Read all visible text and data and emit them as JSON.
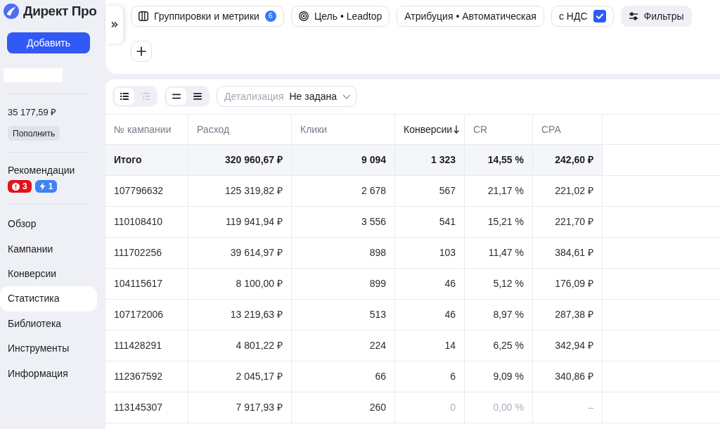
{
  "sidebar": {
    "logo": {
      "text": "Директ Про"
    },
    "add_button": "Добавить",
    "balance": "35 177,59 ₽",
    "top_up_button": "Пополнить",
    "recommendations": {
      "title": "Рекомендации",
      "badges": [
        {
          "kind": "alert",
          "count": "3",
          "color": "#e3111b"
        },
        {
          "kind": "boost",
          "count": "1",
          "color": "#3d82f6"
        }
      ]
    },
    "nav_items": [
      {
        "label": "Обзор",
        "selected": false
      },
      {
        "label": "Кампании",
        "selected": false
      },
      {
        "label": "Конверсии",
        "selected": false
      },
      {
        "label": "Статистика",
        "selected": true
      },
      {
        "label": "Библиотека",
        "selected": false
      },
      {
        "label": "Инструменты",
        "selected": false
      },
      {
        "label": "Информация",
        "selected": false
      }
    ]
  },
  "filters": {
    "chips": [
      {
        "kind": "groupings",
        "label": "Группировки и метрики",
        "badge": "6"
      },
      {
        "kind": "goal",
        "label": "Цель • Leadtop"
      },
      {
        "kind": "attribution",
        "label": "Атрибуция • Автоматическая"
      },
      {
        "kind": "vat",
        "label": "с НДС",
        "checked": true
      },
      {
        "kind": "filters",
        "label": "Фильтры"
      }
    ]
  },
  "toolbar": {
    "view_toggle": [
      {
        "kind": "list",
        "selected": true,
        "disabled": false
      },
      {
        "kind": "grouped-list",
        "selected": false,
        "disabled": true
      }
    ],
    "density_toggle": [
      {
        "kind": "two-lines",
        "selected": true
      },
      {
        "kind": "three-lines",
        "selected": false
      }
    ],
    "detail_dropdown": {
      "label": "Детализация",
      "value": "Не задана"
    }
  },
  "table": {
    "columns": [
      {
        "label": "№ кампании",
        "sorted": false
      },
      {
        "label": "Расход",
        "sorted": false
      },
      {
        "label": "Клики",
        "sorted": false
      },
      {
        "label": "Конверсии",
        "sorted": true
      },
      {
        "label": "CR",
        "sorted": false
      },
      {
        "label": "CPA",
        "sorted": false
      }
    ],
    "rows": [
      {
        "kind": "total",
        "cells": [
          {
            "text": "Итого",
            "muted": false
          },
          {
            "text": "320 960,67 ₽",
            "muted": false
          },
          {
            "text": "9 094",
            "muted": false
          },
          {
            "text": "1 323",
            "muted": false
          },
          {
            "text": "14,55 %",
            "muted": false
          },
          {
            "text": "242,60 ₽",
            "muted": false
          }
        ]
      },
      {
        "kind": "campaign",
        "cells": [
          {
            "text": "107796632",
            "muted": false
          },
          {
            "text": "125 319,82 ₽",
            "muted": false
          },
          {
            "text": "2 678",
            "muted": false
          },
          {
            "text": "567",
            "muted": false
          },
          {
            "text": "21,17 %",
            "muted": false
          },
          {
            "text": "221,02 ₽",
            "muted": false
          }
        ]
      },
      {
        "kind": "campaign",
        "cells": [
          {
            "text": "110108410",
            "muted": false
          },
          {
            "text": "119 941,94 ₽",
            "muted": false
          },
          {
            "text": "3 556",
            "muted": false
          },
          {
            "text": "541",
            "muted": false
          },
          {
            "text": "15,21 %",
            "muted": false
          },
          {
            "text": "221,70 ₽",
            "muted": false
          }
        ]
      },
      {
        "kind": "campaign",
        "cells": [
          {
            "text": "111702256",
            "muted": false
          },
          {
            "text": "39 614,97 ₽",
            "muted": false
          },
          {
            "text": "898",
            "muted": false
          },
          {
            "text": "103",
            "muted": false
          },
          {
            "text": "11,47 %",
            "muted": false
          },
          {
            "text": "384,61 ₽",
            "muted": false
          }
        ]
      },
      {
        "kind": "campaign",
        "cells": [
          {
            "text": "104115617",
            "muted": false
          },
          {
            "text": "8 100,00 ₽",
            "muted": false
          },
          {
            "text": "899",
            "muted": false
          },
          {
            "text": "46",
            "muted": false
          },
          {
            "text": "5,12 %",
            "muted": false
          },
          {
            "text": "176,09 ₽",
            "muted": false
          }
        ]
      },
      {
        "kind": "campaign",
        "cells": [
          {
            "text": "107172006",
            "muted": false
          },
          {
            "text": "13 219,63 ₽",
            "muted": false
          },
          {
            "text": "513",
            "muted": false
          },
          {
            "text": "46",
            "muted": false
          },
          {
            "text": "8,97 %",
            "muted": false
          },
          {
            "text": "287,38 ₽",
            "muted": false
          }
        ]
      },
      {
        "kind": "campaign",
        "cells": [
          {
            "text": "111428291",
            "muted": false
          },
          {
            "text": "4 801,22 ₽",
            "muted": false
          },
          {
            "text": "224",
            "muted": false
          },
          {
            "text": "14",
            "muted": false
          },
          {
            "text": "6,25 %",
            "muted": false
          },
          {
            "text": "342,94 ₽",
            "muted": false
          }
        ]
      },
      {
        "kind": "campaign",
        "cells": [
          {
            "text": "112367592",
            "muted": false
          },
          {
            "text": "2 045,17 ₽",
            "muted": false
          },
          {
            "text": "66",
            "muted": false
          },
          {
            "text": "6",
            "muted": false
          },
          {
            "text": "9,09 %",
            "muted": false
          },
          {
            "text": "340,86 ₽",
            "muted": false
          }
        ]
      },
      {
        "kind": "campaign",
        "cells": [
          {
            "text": "113145307",
            "muted": false
          },
          {
            "text": "7 917,93 ₽",
            "muted": false
          },
          {
            "text": "260",
            "muted": false
          },
          {
            "text": "0",
            "muted": true
          },
          {
            "text": "0,00 %",
            "muted": true
          },
          {
            "text": "–",
            "muted": true
          }
        ]
      }
    ]
  }
}
